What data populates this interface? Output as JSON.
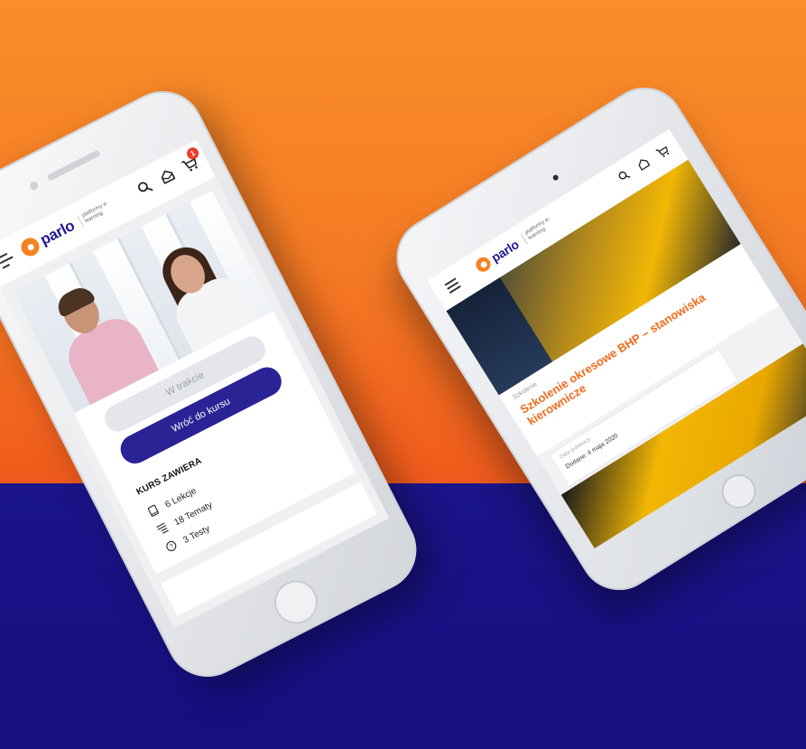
{
  "left_phone": {
    "header": {
      "logo_text": "parlo",
      "logo_tagline": "platformy e-learning",
      "cart_count": "1"
    },
    "course": {
      "status_label": "W trakcie",
      "back_button_label": "Wróć do kursu",
      "contains_title": "KURS ZAWIERA",
      "items": [
        {
          "icon": "book-icon",
          "label": "6 Lekcje"
        },
        {
          "icon": "list-icon",
          "label": "18 Tematy"
        },
        {
          "icon": "question-icon",
          "label": "3 Testy"
        }
      ]
    }
  },
  "right_phone": {
    "header": {
      "logo_text": "parlo",
      "logo_tagline": "platformy e-learning"
    },
    "article": {
      "category": "Szkolenie",
      "title": "Szkolenie okresowe BHP – stanowiska kierownicze",
      "meta_label": "Data publikacji",
      "meta_date": "Dodane: 4 maja 2020"
    }
  },
  "colors": {
    "orange": "#f5781f",
    "navy": "#1b148a",
    "brand_orange": "#f58220",
    "button_blue": "#2a2395"
  }
}
